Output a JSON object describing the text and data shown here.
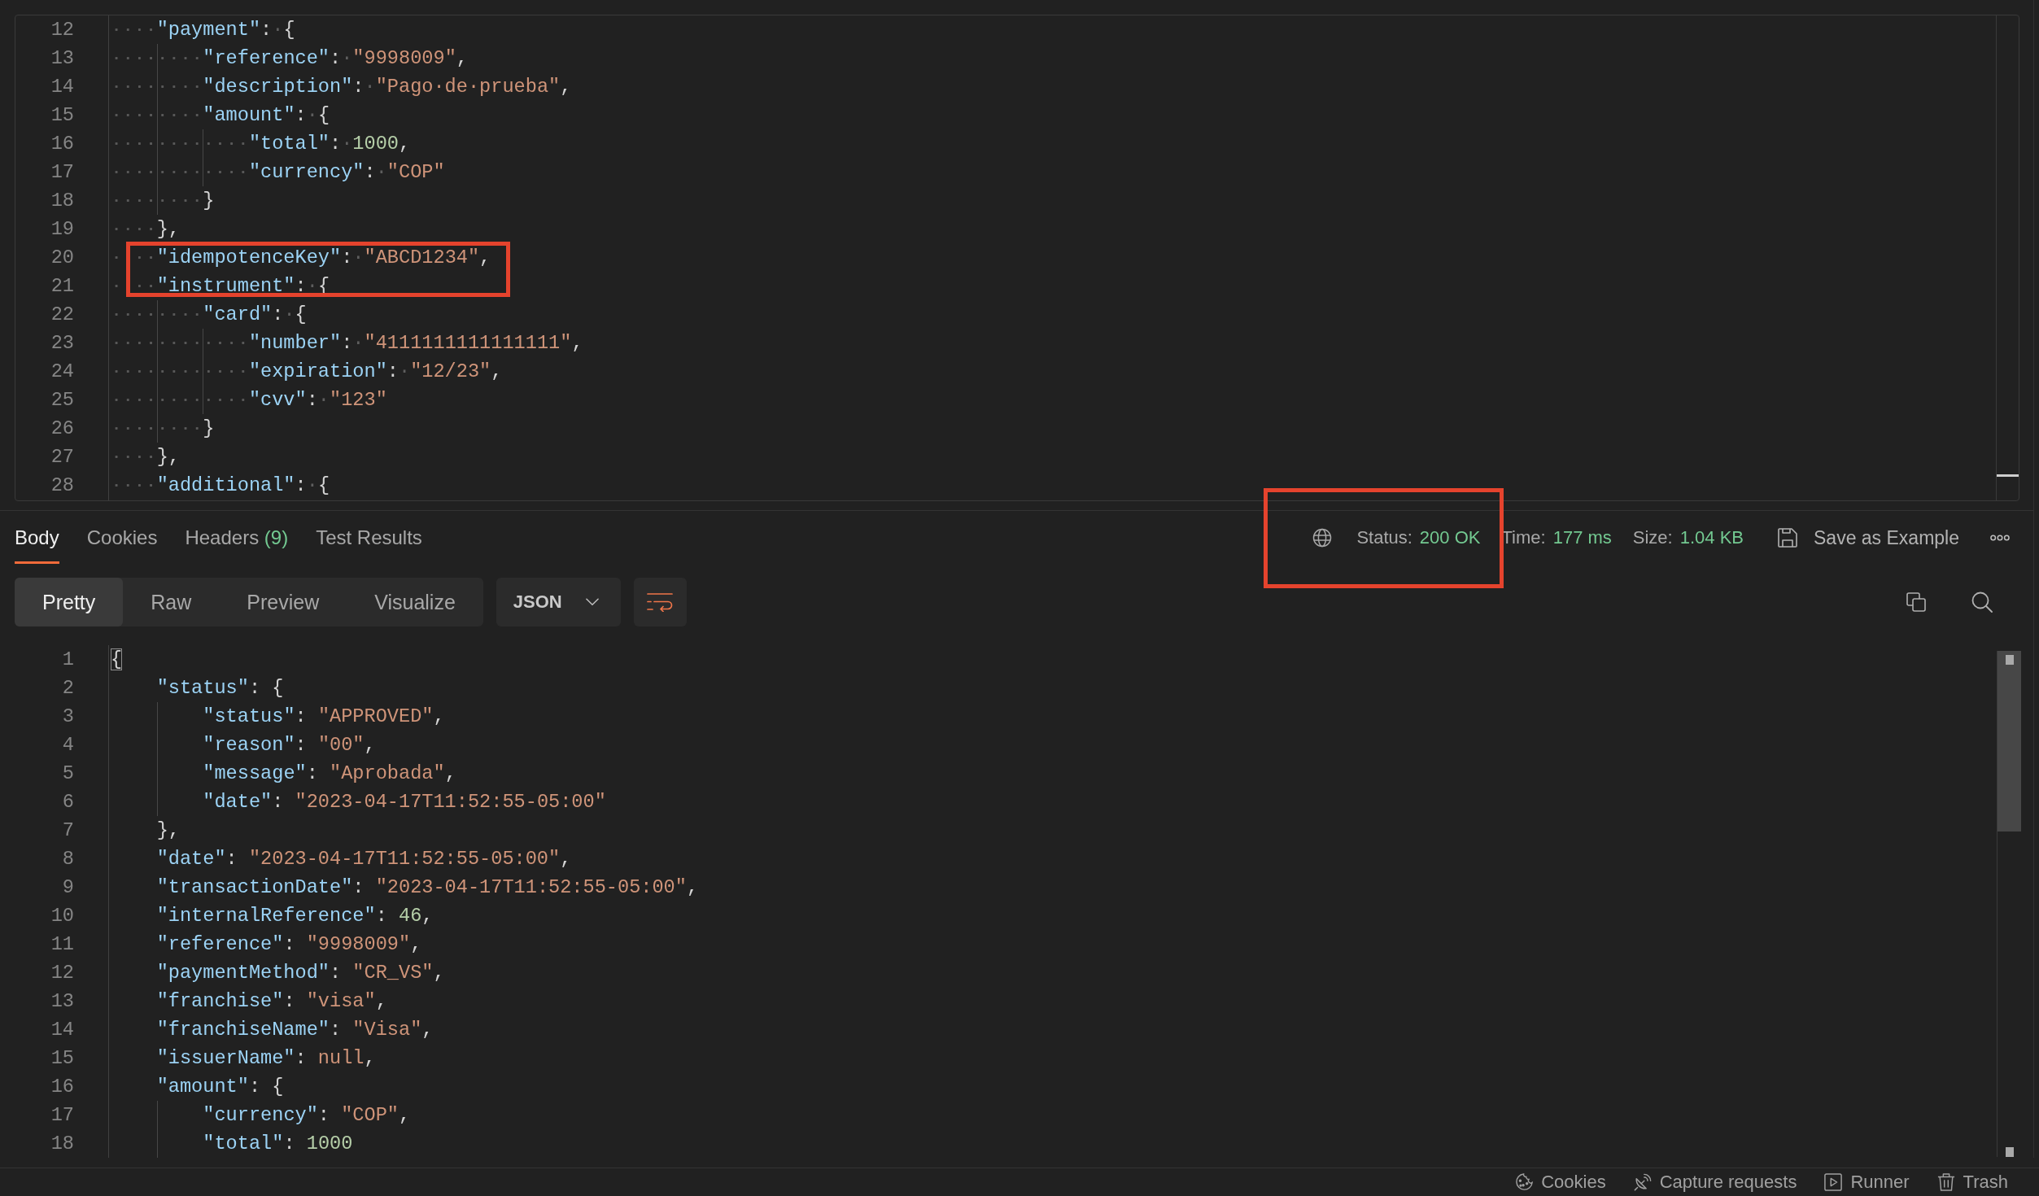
{
  "request_editor": {
    "whitespace_visible": true,
    "lines": [
      {
        "number": "12",
        "tokens": [
          {
            "kind": "key",
            "text": "\"payment\""
          },
          {
            "kind": "punct",
            "text": ":"
          },
          {
            "kind": "space",
            "text": "·"
          },
          {
            "kind": "punct",
            "text": "{"
          }
        ],
        "children": [
          {
            "number": "13",
            "tokens": [
              {
                "kind": "key",
                "text": "\"reference\""
              },
              {
                "kind": "punct",
                "text": ":"
              },
              {
                "kind": "space",
                "text": "·"
              },
              {
                "kind": "string",
                "text": "\"9998009\""
              },
              {
                "kind": "punct",
                "text": ","
              }
            ]
          },
          {
            "number": "14",
            "tokens": [
              {
                "kind": "key",
                "text": "\"description\""
              },
              {
                "kind": "punct",
                "text": ":"
              },
              {
                "kind": "space",
                "text": "·"
              },
              {
                "kind": "string",
                "text": "\"Pago·de·prueba\""
              },
              {
                "kind": "punct",
                "text": ","
              }
            ]
          },
          {
            "number": "15",
            "tokens": [
              {
                "kind": "key",
                "text": "\"amount\""
              },
              {
                "kind": "punct",
                "text": ":"
              },
              {
                "kind": "space",
                "text": "·"
              },
              {
                "kind": "punct",
                "text": "{"
              }
            ],
            "children": [
              {
                "number": "16",
                "tokens": [
                  {
                    "kind": "key",
                    "text": "\"total\""
                  },
                  {
                    "kind": "punct",
                    "text": ":"
                  },
                  {
                    "kind": "space",
                    "text": "·"
                  },
                  {
                    "kind": "number",
                    "text": "1000"
                  },
                  {
                    "kind": "punct",
                    "text": ","
                  }
                ]
              },
              {
                "number": "17",
                "tokens": [
                  {
                    "kind": "key",
                    "text": "\"currency\""
                  },
                  {
                    "kind": "punct",
                    "text": ":"
                  },
                  {
                    "kind": "space",
                    "text": "·"
                  },
                  {
                    "kind": "string",
                    "text": "\"COP\""
                  }
                ]
              }
            ]
          },
          {
            "number": "18",
            "tokens": [
              {
                "kind": "punct",
                "text": "}"
              }
            ]
          }
        ]
      },
      {
        "number": "19",
        "tokens": [
          {
            "kind": "punct",
            "text": "},"
          }
        ]
      },
      {
        "number": "20",
        "tokens": [
          {
            "kind": "key",
            "text": "\"idempotenceKey\""
          },
          {
            "kind": "punct",
            "text": ":"
          },
          {
            "kind": "space",
            "text": "·"
          },
          {
            "kind": "string",
            "text": "\"ABCD1234\""
          },
          {
            "kind": "punct",
            "text": ","
          }
        ]
      },
      {
        "number": "21",
        "tokens": [
          {
            "kind": "key",
            "text": "\"instrument\""
          },
          {
            "kind": "punct",
            "text": ":"
          },
          {
            "kind": "space",
            "text": "·"
          },
          {
            "kind": "punct",
            "text": "{"
          }
        ],
        "children": [
          {
            "number": "22",
            "tokens": [
              {
                "kind": "key",
                "text": "\"card\""
              },
              {
                "kind": "punct",
                "text": ":"
              },
              {
                "kind": "space",
                "text": "·"
              },
              {
                "kind": "punct",
                "text": "{"
              }
            ],
            "children": [
              {
                "number": "23",
                "tokens": [
                  {
                    "kind": "key",
                    "text": "\"number\""
                  },
                  {
                    "kind": "punct",
                    "text": ":"
                  },
                  {
                    "kind": "space",
                    "text": "·"
                  },
                  {
                    "kind": "string",
                    "text": "\"4111111111111111\""
                  },
                  {
                    "kind": "punct",
                    "text": ","
                  }
                ]
              },
              {
                "number": "24",
                "tokens": [
                  {
                    "kind": "key",
                    "text": "\"expiration\""
                  },
                  {
                    "kind": "punct",
                    "text": ":"
                  },
                  {
                    "kind": "space",
                    "text": "·"
                  },
                  {
                    "kind": "string",
                    "text": "\"12/23\""
                  },
                  {
                    "kind": "punct",
                    "text": ","
                  }
                ]
              },
              {
                "number": "25",
                "tokens": [
                  {
                    "kind": "key",
                    "text": "\"cvv\""
                  },
                  {
                    "kind": "punct",
                    "text": ":"
                  },
                  {
                    "kind": "space",
                    "text": "·"
                  },
                  {
                    "kind": "string",
                    "text": "\"123\""
                  }
                ]
              }
            ]
          },
          {
            "number": "26",
            "tokens": [
              {
                "kind": "punct",
                "text": "}"
              }
            ]
          }
        ]
      },
      {
        "number": "27",
        "tokens": [
          {
            "kind": "punct",
            "text": "},"
          }
        ]
      },
      {
        "number": "28",
        "tokens": [
          {
            "kind": "key",
            "text": "\"additional\""
          },
          {
            "kind": "punct",
            "text": ":"
          },
          {
            "kind": "space",
            "text": "·"
          },
          {
            "kind": "punct",
            "text": "{"
          }
        ]
      }
    ]
  },
  "response_tabs": [
    {
      "label": "Body",
      "selected": true
    },
    {
      "label": "Cookies",
      "selected": false
    },
    {
      "label": "Headers",
      "count": "(9)",
      "selected": false
    },
    {
      "label": "Test Results",
      "selected": false
    }
  ],
  "response_meta": [
    {
      "label": "Status:",
      "value": "200 OK"
    },
    {
      "label": "Time:",
      "value": "177 ms"
    },
    {
      "label": "Size:",
      "value": "1.04 KB"
    }
  ],
  "save_button": {
    "label": "Save as Example"
  },
  "view_modes": [
    {
      "label": "Pretty",
      "selected": true
    },
    {
      "label": "Raw",
      "selected": false
    },
    {
      "label": "Preview",
      "selected": false
    },
    {
      "label": "Visualize",
      "selected": false
    }
  ],
  "format_dropdown": {
    "value": "JSON"
  },
  "wrap_lines": {
    "on": true
  },
  "response_editor": {
    "lines": [
      {
        "number": "1",
        "tokens": [
          {
            "kind": "bracket",
            "text": "{"
          }
        ],
        "children": [
          {
            "number": "2",
            "tokens": [
              {
                "kind": "key",
                "text": "\"status\""
              },
              {
                "kind": "punct",
                "text": ": {"
              }
            ],
            "children": [
              {
                "number": "3",
                "tokens": [
                  {
                    "kind": "key",
                    "text": "\"status\""
                  },
                  {
                    "kind": "punct",
                    "text": ": "
                  },
                  {
                    "kind": "string",
                    "text": "\"APPROVED\""
                  },
                  {
                    "kind": "punct",
                    "text": ","
                  }
                ]
              },
              {
                "number": "4",
                "tokens": [
                  {
                    "kind": "key",
                    "text": "\"reason\""
                  },
                  {
                    "kind": "punct",
                    "text": ": "
                  },
                  {
                    "kind": "string",
                    "text": "\"00\""
                  },
                  {
                    "kind": "punct",
                    "text": ","
                  }
                ]
              },
              {
                "number": "5",
                "tokens": [
                  {
                    "kind": "key",
                    "text": "\"message\""
                  },
                  {
                    "kind": "punct",
                    "text": ": "
                  },
                  {
                    "kind": "string",
                    "text": "\"Aprobada\""
                  },
                  {
                    "kind": "punct",
                    "text": ","
                  }
                ]
              },
              {
                "number": "6",
                "tokens": [
                  {
                    "kind": "key",
                    "text": "\"date\""
                  },
                  {
                    "kind": "punct",
                    "text": ": "
                  },
                  {
                    "kind": "string",
                    "text": "\"2023-04-17T11:52:55-05:00\""
                  }
                ]
              }
            ]
          },
          {
            "number": "7",
            "tokens": [
              {
                "kind": "punct",
                "text": "},"
              }
            ]
          },
          {
            "number": "8",
            "tokens": [
              {
                "kind": "key",
                "text": "\"date\""
              },
              {
                "kind": "punct",
                "text": ": "
              },
              {
                "kind": "string",
                "text": "\"2023-04-17T11:52:55-05:00\""
              },
              {
                "kind": "punct",
                "text": ","
              }
            ]
          },
          {
            "number": "9",
            "tokens": [
              {
                "kind": "key",
                "text": "\"transactionDate\""
              },
              {
                "kind": "punct",
                "text": ": "
              },
              {
                "kind": "string",
                "text": "\"2023-04-17T11:52:55-05:00\""
              },
              {
                "kind": "punct",
                "text": ","
              }
            ]
          },
          {
            "number": "10",
            "tokens": [
              {
                "kind": "key",
                "text": "\"internalReference\""
              },
              {
                "kind": "punct",
                "text": ": "
              },
              {
                "kind": "number",
                "text": "46"
              },
              {
                "kind": "punct",
                "text": ","
              }
            ]
          },
          {
            "number": "11",
            "tokens": [
              {
                "kind": "key",
                "text": "\"reference\""
              },
              {
                "kind": "punct",
                "text": ": "
              },
              {
                "kind": "string",
                "text": "\"9998009\""
              },
              {
                "kind": "punct",
                "text": ","
              }
            ]
          },
          {
            "number": "12",
            "tokens": [
              {
                "kind": "key",
                "text": "\"paymentMethod\""
              },
              {
                "kind": "punct",
                "text": ": "
              },
              {
                "kind": "string",
                "text": "\"CR_VS\""
              },
              {
                "kind": "punct",
                "text": ","
              }
            ]
          },
          {
            "number": "13",
            "tokens": [
              {
                "kind": "key",
                "text": "\"franchise\""
              },
              {
                "kind": "punct",
                "text": ": "
              },
              {
                "kind": "string",
                "text": "\"visa\""
              },
              {
                "kind": "punct",
                "text": ","
              }
            ]
          },
          {
            "number": "14",
            "tokens": [
              {
                "kind": "key",
                "text": "\"franchiseName\""
              },
              {
                "kind": "punct",
                "text": ": "
              },
              {
                "kind": "string",
                "text": "\"Visa\""
              },
              {
                "kind": "punct",
                "text": ","
              }
            ]
          },
          {
            "number": "15",
            "tokens": [
              {
                "kind": "key",
                "text": "\"issuerName\""
              },
              {
                "kind": "punct",
                "text": ": "
              },
              {
                "kind": "literal",
                "text": "null"
              },
              {
                "kind": "punct",
                "text": ","
              }
            ]
          },
          {
            "number": "16",
            "tokens": [
              {
                "kind": "key",
                "text": "\"amount\""
              },
              {
                "kind": "punct",
                "text": ": {"
              }
            ],
            "children": [
              {
                "number": "17",
                "tokens": [
                  {
                    "kind": "key",
                    "text": "\"currency\""
                  },
                  {
                    "kind": "punct",
                    "text": ": "
                  },
                  {
                    "kind": "string",
                    "text": "\"COP\""
                  },
                  {
                    "kind": "punct",
                    "text": ","
                  }
                ]
              },
              {
                "number": "18",
                "tokens": [
                  {
                    "kind": "key",
                    "text": "\"total\""
                  },
                  {
                    "kind": "punct",
                    "text": ": "
                  },
                  {
                    "kind": "number",
                    "text": "1000"
                  }
                ]
              }
            ]
          }
        ]
      }
    ]
  },
  "status_bar": {
    "items": [
      {
        "label": "Cookies"
      },
      {
        "label": "Capture requests"
      },
      {
        "label": "Runner"
      },
      {
        "label": "Trash"
      }
    ]
  },
  "annotations": [
    {
      "kind": "rectangle"
    },
    {
      "kind": "rectangle"
    }
  ]
}
